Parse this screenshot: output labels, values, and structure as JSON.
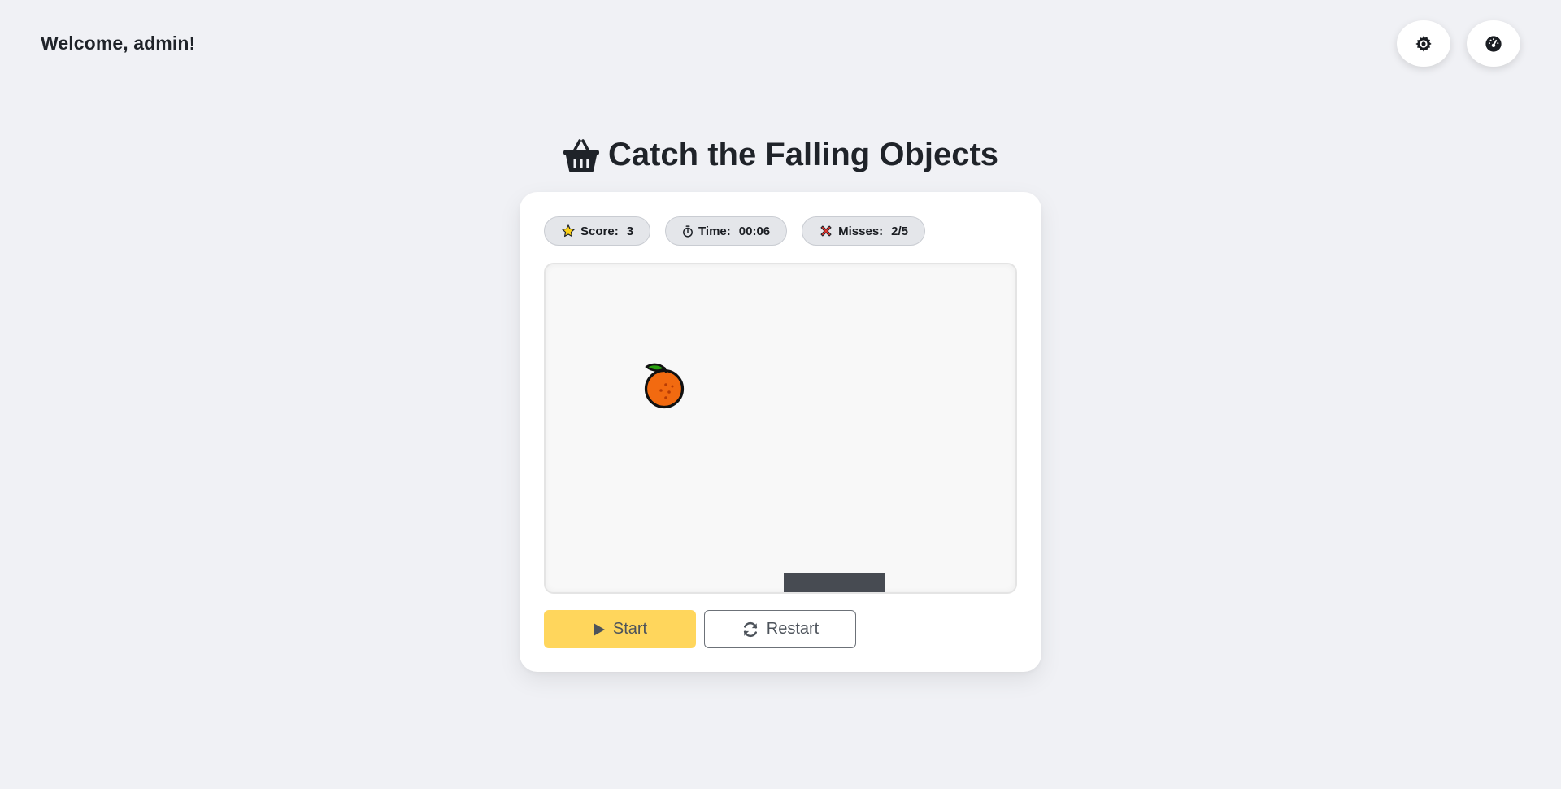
{
  "header": {
    "welcome": "Welcome, admin!",
    "settings_icon": "gear-icon",
    "dashboard_icon": "dashboard-icon"
  },
  "game": {
    "title": "Catch the Falling Objects",
    "title_icon": "basket-icon",
    "stats": {
      "score_label": "Score:",
      "score_value": "3",
      "time_label": "Time:",
      "time_value": "00:06",
      "misses_label": "Misses:",
      "misses_value": "2/5"
    },
    "falling_object": "orange",
    "controls": {
      "start_label": "Start",
      "restart_label": "Restart"
    }
  },
  "colors": {
    "background": "#f0f1f5",
    "start_button": "#ffd65c",
    "paddle": "#474b52",
    "orange": "#f26a10",
    "leaf": "#2aa10f"
  }
}
